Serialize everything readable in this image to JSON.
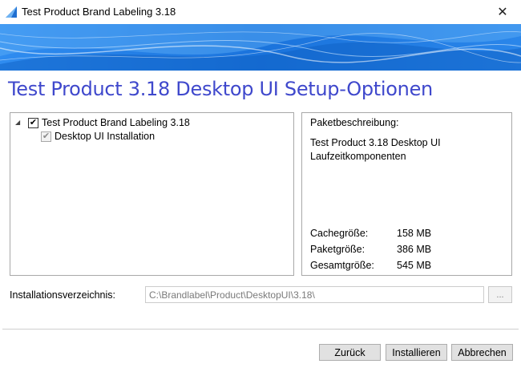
{
  "window": {
    "title": "Test Product Brand Labeling 3.18",
    "icon": "app-icon",
    "close_glyph": "✕"
  },
  "banner": {
    "accent": "#1c7fe0"
  },
  "heading": "Test Product 3.18 Desktop UI Setup-Optionen",
  "tree": {
    "root": {
      "label": "Test Product Brand Labeling 3.18",
      "checked": true,
      "expanded": true
    },
    "child": {
      "label": "Desktop UI Installation",
      "checked": true,
      "enabled": false
    }
  },
  "info": {
    "heading": "Paketbeschreibung:",
    "description": "Test Product 3.18 Desktop UI Laufzeitkomponenten",
    "sizes": [
      {
        "label": "Cachegröße:",
        "value": "158 MB"
      },
      {
        "label": "Paketgröße:",
        "value": "386 MB"
      },
      {
        "label": "Gesamtgröße:",
        "value": "545 MB"
      }
    ]
  },
  "install_dir": {
    "label": "Installationsverzeichnis:",
    "value": "C:\\Brandlabel\\Product\\DesktopUI\\3.18\\",
    "browse_label": "..."
  },
  "buttons": {
    "back": "Zurück",
    "install": "Installieren",
    "cancel": "Abbrechen"
  },
  "colors": {
    "heading": "#3f48cc"
  }
}
